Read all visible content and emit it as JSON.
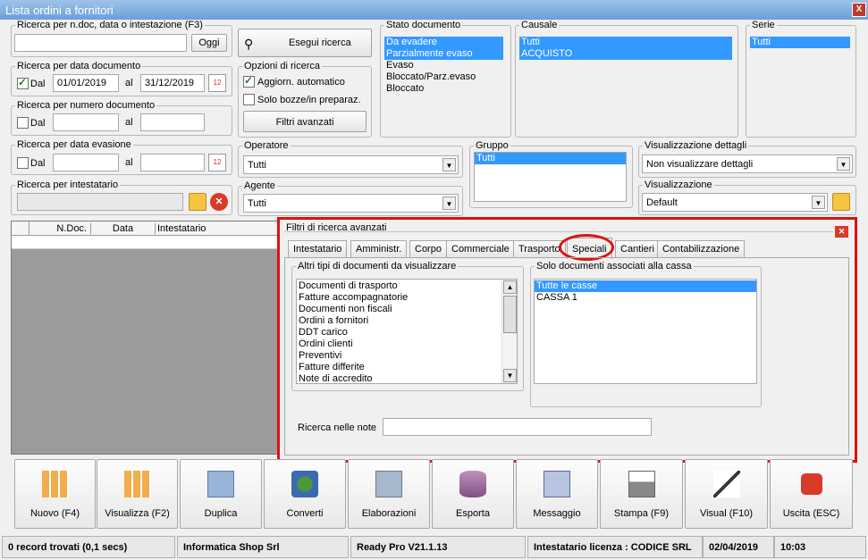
{
  "window": {
    "title": "Lista ordini a fornitori",
    "close_label": "X"
  },
  "search": {
    "ndoc_group": "Ricerca per n.doc, data o intestazione (F3)",
    "ok_btn": "Oggi",
    "exec_btn": "Esegui ricerca",
    "date_group": "Ricerca per data documento",
    "dal": "Dal",
    "al": "al",
    "date_from": "01/01/2019",
    "date_to": "31/12/2019",
    "num_group": "Ricerca per numero documento",
    "evas_group": "Ricerca per data evasione",
    "intest_group": "Ricerca per intestatario",
    "opts_group": "Opzioni di ricerca",
    "aggiorn": "Aggiorn. automatico",
    "bozze": "Solo bozze/in preparaz.",
    "filtri_btn": "Filtri avanzati"
  },
  "stato": {
    "label": "Stato documento",
    "items": [
      "Da evadere",
      "Parzialmente evaso",
      "Evaso",
      "Bloccato/Parz.evaso",
      "Bloccato"
    ]
  },
  "causale": {
    "label": "Causale",
    "items": [
      "Tutti",
      "ACQUISTO"
    ]
  },
  "serie": {
    "label": "Serie",
    "items": [
      "Tutti"
    ]
  },
  "operatore": {
    "label": "Operatore",
    "value": "Tutti"
  },
  "agente": {
    "label": "Agente",
    "value": "Tutti"
  },
  "gruppo": {
    "label": "Gruppo",
    "items": [
      "Tutti"
    ]
  },
  "vis_dettagli": {
    "label": "Visualizzazione dettagli",
    "value": "Non visualizzare dettagli"
  },
  "visualizzazione": {
    "label": "Visualizzazione",
    "value": "Default"
  },
  "grid": {
    "columns": [
      "N.Doc.",
      "Data",
      "Intestatario"
    ]
  },
  "advanced": {
    "title": "Filtri di ricerca avanzati",
    "tabs": [
      "Intestatario",
      "Amministr.",
      "Corpo",
      "Commerciale",
      "Trasporto",
      "Speciali",
      "Cantieri",
      "Contabilizzazione"
    ],
    "other_docs_label": "Altri tipi di documenti da visualizzare",
    "other_docs": [
      "Documenti di trasporto",
      "Fatture accompagnatorie",
      "Documenti non fiscali",
      "Ordini a fornitori",
      "DDT carico",
      "Ordini clienti",
      "Preventivi",
      "Fatture differite",
      "Note di accredito"
    ],
    "cassa_label": "Solo documenti associati alla cassa",
    "cassa": [
      "Tutte le casse",
      "CASSA 1"
    ],
    "notes_label": "Ricerca nelle note"
  },
  "toolbar": [
    "Nuovo (F4)",
    "Visualizza (F2)",
    "Duplica",
    "Converti",
    "Elaborazioni",
    "Esporta",
    "Messaggio",
    "Stampa (F9)",
    "Visual (F10)",
    "Uscita (ESC)"
  ],
  "statusbar": {
    "records": "0 record trovati (0,1 secs)",
    "company": "Informatica Shop Srl",
    "version": "Ready Pro V21.1.13",
    "license": "Intestatario licenza : CODICE SRL",
    "date": "02/04/2019",
    "time": "10:03"
  },
  "colors": {
    "highlight": "#3399ff",
    "annotation": "#e01010"
  }
}
